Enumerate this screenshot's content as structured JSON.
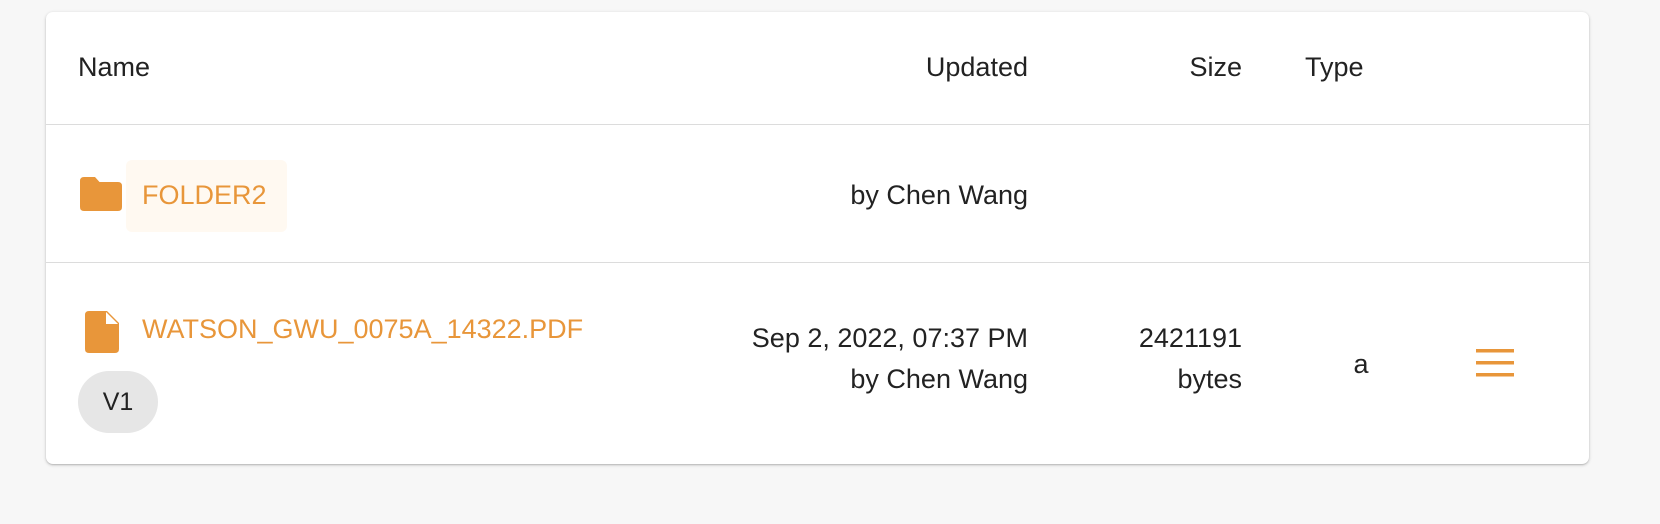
{
  "colors": {
    "accent": "#e8963a",
    "page_background": "#f7f7f7",
    "card_background": "#ffffff",
    "badge_background": "#e6e6e6"
  },
  "table": {
    "headers": {
      "name": "Name",
      "updated": "Updated",
      "size": "Size",
      "type": "Type"
    },
    "rows": [
      {
        "kind": "folder",
        "icon": "folder-icon",
        "name": "FOLDER2",
        "updated_by": "by Chen Wang"
      },
      {
        "kind": "file",
        "icon": "file-icon",
        "name": "WATSON_GWU_0075A_14322.PDF",
        "version": "V1",
        "updated_date": "Sep 2, 2022, 07:37 PM",
        "updated_by": "by Chen Wang",
        "size_value": "2421191",
        "size_unit": "bytes",
        "type": "a",
        "action_icon": "menu-icon"
      }
    ]
  }
}
